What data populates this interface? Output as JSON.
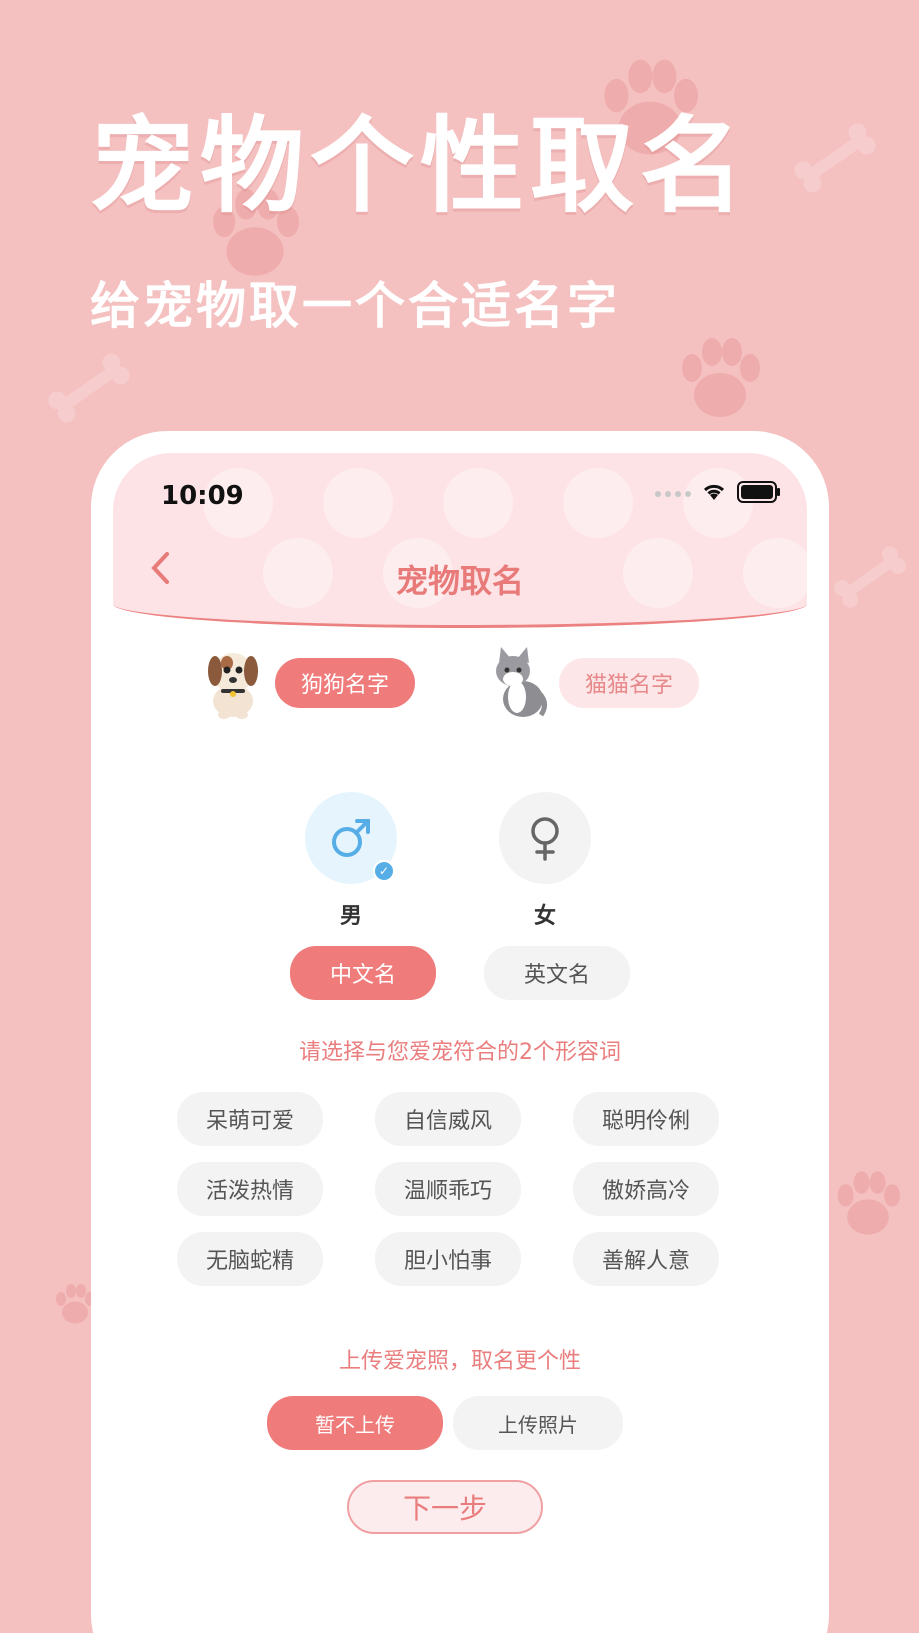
{
  "promo": {
    "title": "宠物个性取名",
    "subtitle": "给宠物取一个合适名字"
  },
  "colors": {
    "background": "#f4c0c0",
    "accent": "#ef7b7b",
    "accent_soft": "#fde6e7",
    "male_blue": "#57aee7"
  },
  "status_bar": {
    "time": "10:09",
    "icons": [
      "signal-icon",
      "wifi-icon",
      "battery-icon"
    ]
  },
  "nav": {
    "back_icon": "chevron-left-icon",
    "title": "宠物取名"
  },
  "pet_types": [
    {
      "label": "狗狗名字",
      "icon": "dog-icon",
      "selected": true
    },
    {
      "label": "猫猫名字",
      "icon": "cat-icon",
      "selected": false
    }
  ],
  "genders": [
    {
      "label": "男",
      "icon": "male-icon",
      "selected": true
    },
    {
      "label": "女",
      "icon": "female-icon",
      "selected": false
    }
  ],
  "name_languages": [
    {
      "label": "中文名",
      "selected": true
    },
    {
      "label": "英文名",
      "selected": false
    }
  ],
  "adjectives": {
    "hint": "请选择与您爱宠符合的2个形容词",
    "items": [
      "呆萌可爱",
      "自信威风",
      "聪明伶俐",
      "活泼热情",
      "温顺乖巧",
      "傲娇高冷",
      "无脑蛇精",
      "胆小怕事",
      "善解人意"
    ]
  },
  "upload": {
    "hint": "上传爱宠照，取名更个性",
    "skip_label": "暂不上传",
    "upload_label": "上传照片"
  },
  "next_label": "下一步"
}
